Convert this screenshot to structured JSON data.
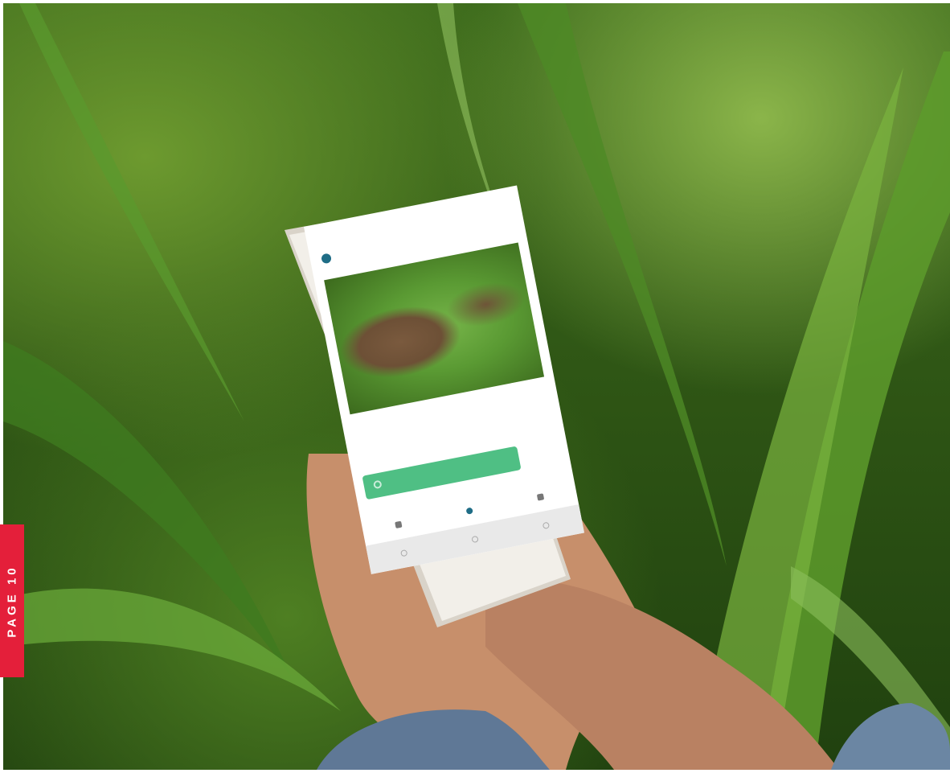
{
  "page_tab": {
    "label": "PAGE 10"
  },
  "app": {
    "fields": [
      {
        "label": "",
        "value": ""
      },
      {
        "label": "",
        "value": ""
      }
    ],
    "action_button": {
      "label": "",
      "icon": "refresh-icon"
    },
    "bottom_nav": [
      {
        "label": "",
        "icon": "home-icon"
      },
      {
        "label": "",
        "icon": "scan-icon"
      },
      {
        "label": "",
        "icon": "profile-icon"
      }
    ]
  },
  "colors": {
    "page_tab": "#e41f3a",
    "action_button": "#4fbf84",
    "brand": "#1f6d86"
  }
}
